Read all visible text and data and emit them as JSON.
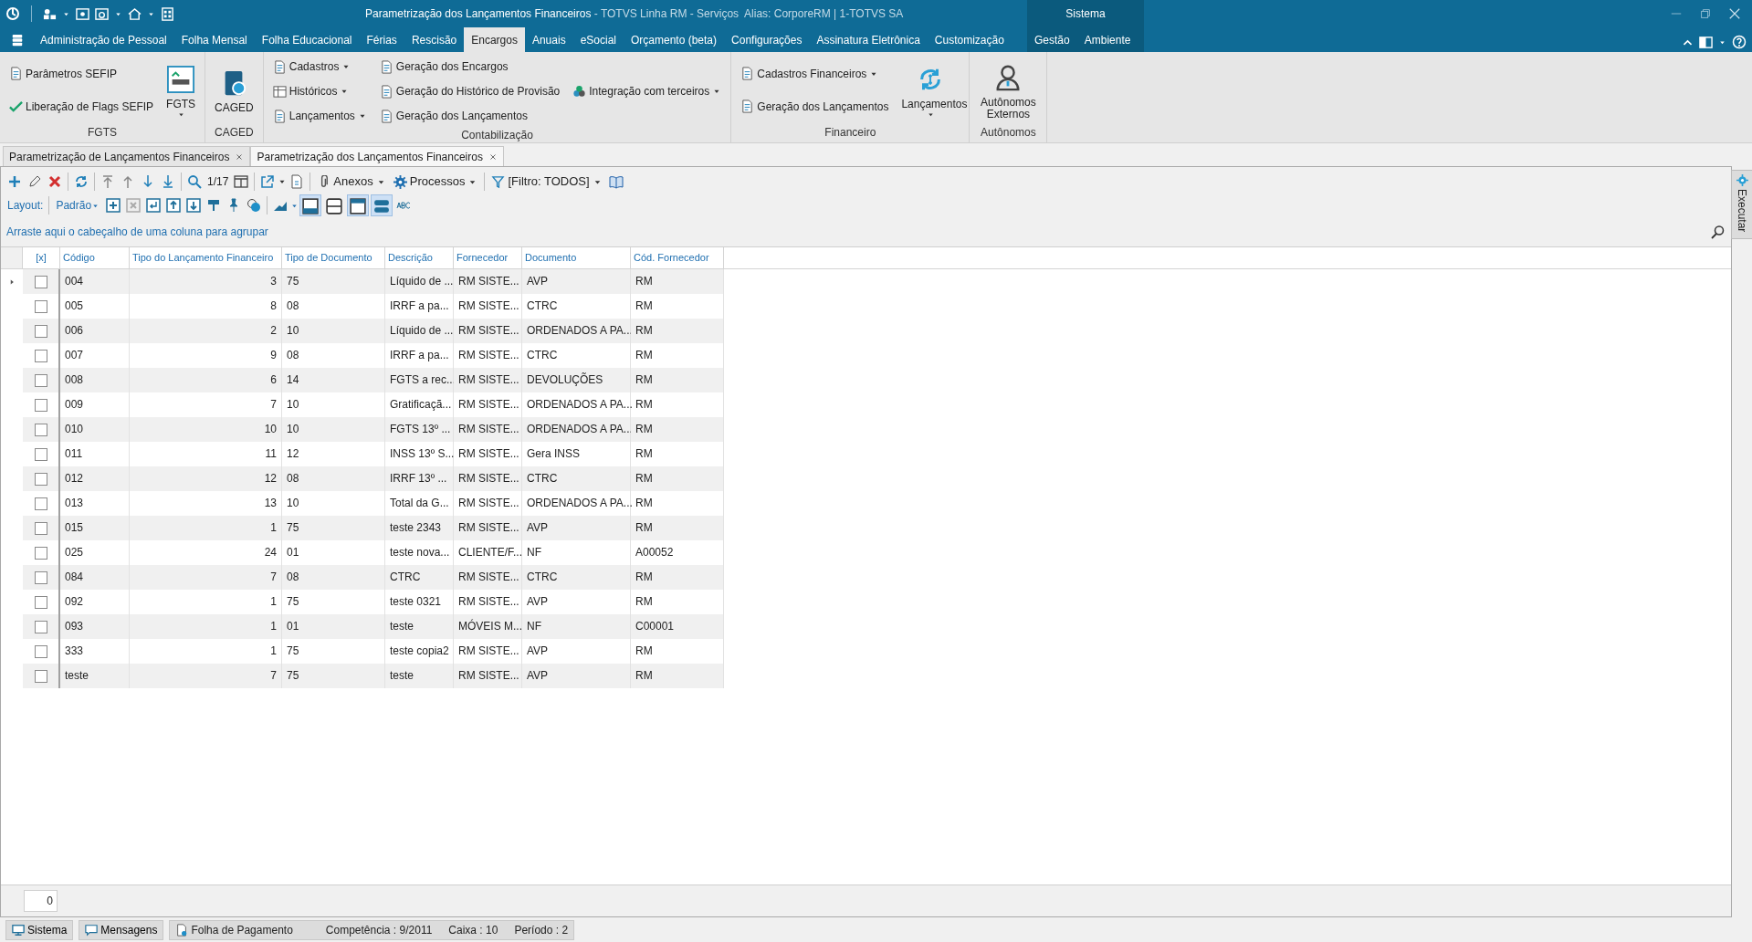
{
  "window": {
    "title": "Parametrização dos Lançamentos Financeiros",
    "subtitle": " - TOTVS Linha RM - Serviços  Alias: CorporeRM | 1-TOTVS SA"
  },
  "menu_tabs": [
    {
      "label": "Administração de Pessoal",
      "selected": false
    },
    {
      "label": "Folha Mensal",
      "selected": false
    },
    {
      "label": "Folha Educacional",
      "selected": false
    },
    {
      "label": "Férias",
      "selected": false
    },
    {
      "label": "Rescisão",
      "selected": false
    },
    {
      "label": "Encargos",
      "selected": true
    },
    {
      "label": "Anuais",
      "selected": false
    },
    {
      "label": "eSocial",
      "selected": false
    },
    {
      "label": "Orçamento (beta)",
      "selected": false
    },
    {
      "label": "Configurações",
      "selected": false
    },
    {
      "label": "Assinatura Eletrônica",
      "selected": false
    },
    {
      "label": "Customização",
      "selected": false
    }
  ],
  "context_group": {
    "label": "Sistema",
    "tabs": [
      {
        "label": "Gestão",
        "selected": false
      },
      {
        "label": "Ambiente",
        "selected": false
      }
    ]
  },
  "ribbon": [
    {
      "label": "FGTS",
      "columns": [
        {
          "items": [
            {
              "label": "Parâmetros SEFIP",
              "kind": "small",
              "dropdown": false
            },
            {
              "label": "Liberação de Flags SEFIP",
              "kind": "small",
              "dropdown": false
            }
          ]
        },
        {
          "items": [
            {
              "label": "FGTS",
              "kind": "large",
              "dropdown": true
            }
          ]
        }
      ]
    },
    {
      "label": "CAGED",
      "columns": [
        {
          "items": [
            {
              "label": "CAGED",
              "kind": "large",
              "dropdown": false
            }
          ]
        }
      ]
    },
    {
      "label": "Contabilização",
      "columns": [
        {
          "items": [
            {
              "label": "Cadastros",
              "kind": "small",
              "dropdown": true
            },
            {
              "label": "Históricos",
              "kind": "small",
              "dropdown": true
            },
            {
              "label": "Lançamentos",
              "kind": "small",
              "dropdown": true
            }
          ]
        },
        {
          "items": [
            {
              "label": "Geração dos Encargos",
              "kind": "small",
              "dropdown": false
            },
            {
              "label": "Geração do Histórico de Provisão",
              "kind": "small",
              "dropdown": false
            },
            {
              "label": "Geração dos Lançamentos",
              "kind": "small",
              "dropdown": false
            }
          ]
        },
        {
          "items": [
            {
              "label": "Integração com terceiros",
              "kind": "small",
              "dropdown": true
            }
          ]
        }
      ]
    },
    {
      "label": "Financeiro",
      "columns": [
        {
          "items": [
            {
              "label": "Cadastros Financeiros",
              "kind": "small",
              "dropdown": true
            },
            {
              "label": "Geração dos Lançamentos",
              "kind": "small",
              "dropdown": false
            }
          ]
        },
        {
          "items": [
            {
              "label": "Lançamentos",
              "kind": "large",
              "dropdown": true
            }
          ]
        }
      ]
    },
    {
      "label": "Autônomos",
      "columns": [
        {
          "items": [
            {
              "label": "Autônomos Externos",
              "kind": "large",
              "dropdown": false
            }
          ]
        }
      ]
    }
  ],
  "doc_tabs": [
    {
      "label": "Parametrização de Lançamentos Financeiros",
      "selected": false
    },
    {
      "label": "Parametrização dos Lançamentos Financeiros",
      "selected": true
    }
  ],
  "toolbar": {
    "page": "1/17",
    "attachments": "Anexos",
    "processes": "Processos",
    "filter": "[Filtro: TODOS]"
  },
  "layout_bar": {
    "label": "Layout:",
    "layout": "Padrão",
    "toggles": [
      {
        "selected": true
      },
      {
        "selected": false
      },
      {
        "selected": true
      },
      {
        "selected": true
      }
    ]
  },
  "group_hint": "Arraste aqui o cabeçalho de uma coluna para agrupar",
  "grid": {
    "select_header": "[x]",
    "columns": [
      "Código",
      "Tipo do Lançamento Financeiro",
      "Tipo de Documento",
      "Descrição",
      "Fornecedor",
      "Documento",
      "Cód. Fornecedor"
    ],
    "rows": [
      {
        "current": true,
        "checked": false,
        "cells": [
          "004",
          "3",
          "75",
          "Líquido de ...",
          "RM SISTE...",
          "AVP",
          "RM"
        ]
      },
      {
        "current": false,
        "checked": false,
        "cells": [
          "005",
          "8",
          "08",
          "IRRF  a pa...",
          "RM SISTE...",
          "CTRC",
          "RM"
        ]
      },
      {
        "current": false,
        "checked": false,
        "cells": [
          "006",
          "2",
          "10",
          "Líquido de ...",
          "RM SISTE...",
          "ORDENADOS A PA...",
          "RM"
        ]
      },
      {
        "current": false,
        "checked": false,
        "cells": [
          "007",
          "9",
          "08",
          "IRRF a pa...",
          "RM SISTE...",
          "CTRC",
          "RM"
        ]
      },
      {
        "current": false,
        "checked": false,
        "cells": [
          "008",
          "6",
          "14",
          "FGTS a rec...",
          "RM SISTE...",
          "DEVOLUÇÕES",
          "RM"
        ]
      },
      {
        "current": false,
        "checked": false,
        "cells": [
          "009",
          "7",
          "10",
          "Gratificaçã...",
          "RM SISTE...",
          "ORDENADOS A PA...",
          "RM"
        ]
      },
      {
        "current": false,
        "checked": false,
        "cells": [
          "010",
          "10",
          "10",
          "FGTS 13º ...",
          "RM SISTE...",
          "ORDENADOS A PA...",
          "RM"
        ]
      },
      {
        "current": false,
        "checked": false,
        "cells": [
          "011",
          "11",
          "12",
          "INSS 13º S...",
          "RM SISTE...",
          "Gera INSS",
          "RM"
        ]
      },
      {
        "current": false,
        "checked": false,
        "cells": [
          "012",
          "12",
          "08",
          "IRRF 13º ...",
          "RM SISTE...",
          "CTRC",
          "RM"
        ]
      },
      {
        "current": false,
        "checked": false,
        "cells": [
          "013",
          "13",
          "10",
          "Total da G...",
          "RM SISTE...",
          "ORDENADOS A PA...",
          "RM"
        ]
      },
      {
        "current": false,
        "checked": false,
        "cells": [
          "015",
          "1",
          "75",
          "teste 2343",
          "RM SISTE...",
          "AVP",
          "RM"
        ]
      },
      {
        "current": false,
        "checked": false,
        "cells": [
          "025",
          "24",
          "01",
          "teste nova...",
          "CLIENTE/F...",
          "NF",
          "A00052"
        ]
      },
      {
        "current": false,
        "checked": false,
        "cells": [
          "084",
          "7",
          "08",
          "CTRC",
          "RM SISTE...",
          "CTRC",
          "RM"
        ]
      },
      {
        "current": false,
        "checked": false,
        "cells": [
          "092",
          "1",
          "75",
          "teste 0321",
          "RM SISTE...",
          "AVP",
          "RM"
        ]
      },
      {
        "current": false,
        "checked": false,
        "cells": [
          "093",
          "1",
          "01",
          "teste",
          "MÓVEIS M...",
          "NF",
          "C00001"
        ]
      },
      {
        "current": false,
        "checked": false,
        "cells": [
          "333",
          "1",
          "75",
          "teste copia2",
          "RM SISTE...",
          "AVP",
          "RM"
        ]
      },
      {
        "current": false,
        "checked": false,
        "cells": [
          "teste",
          "7",
          "75",
          "teste",
          "RM SISTE...",
          "AVP",
          "RM"
        ]
      }
    ]
  },
  "footer": {
    "count": "0"
  },
  "side_panel": {
    "label": "Executar"
  },
  "status_bar": {
    "buttons": [
      "Sistema",
      "Mensagens"
    ],
    "module": "Folha de Pagamento",
    "fields": [
      "Competência : 9/2011",
      "Caixa : 10",
      "Período : 2"
    ]
  }
}
